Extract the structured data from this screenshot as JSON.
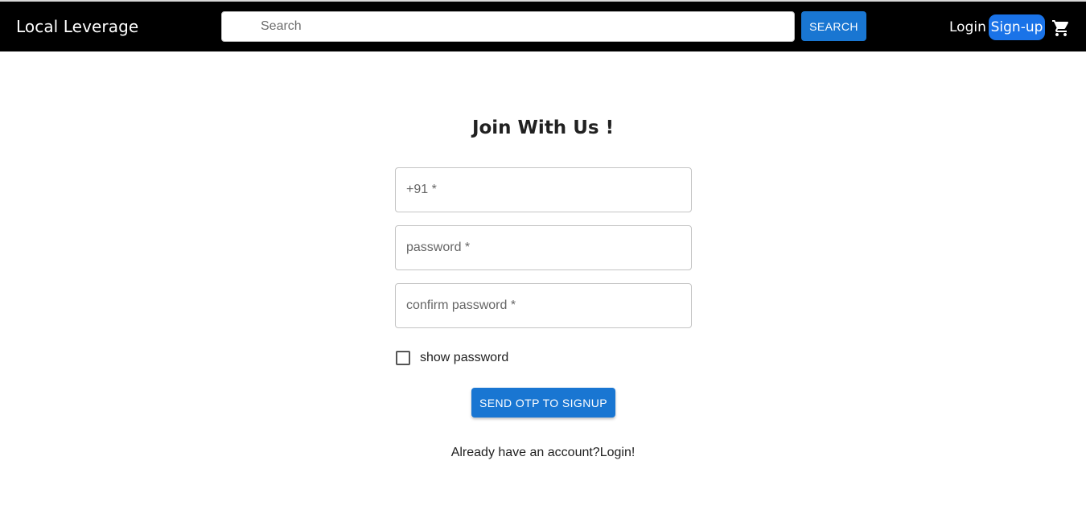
{
  "header": {
    "brand": "Local Leverage",
    "search_placeholder": "Search",
    "search_button": "SEARCH",
    "login_label": "Login",
    "signup_label": "Sign-up",
    "cart_icon": "shopping-cart-icon"
  },
  "form": {
    "title": "Join With Us !",
    "phone_placeholder": "+91 *",
    "password_placeholder": "password *",
    "confirm_password_placeholder": "confirm password *",
    "show_password_label": "show password",
    "show_password_checked": false,
    "submit_label": "SEND OTP TO SIGNUP",
    "already_text": "Already have an account?",
    "login_link": "Login!"
  },
  "colors": {
    "header_bg": "#000000",
    "primary": "#1976d2",
    "signup_bg": "#1a73e8"
  }
}
